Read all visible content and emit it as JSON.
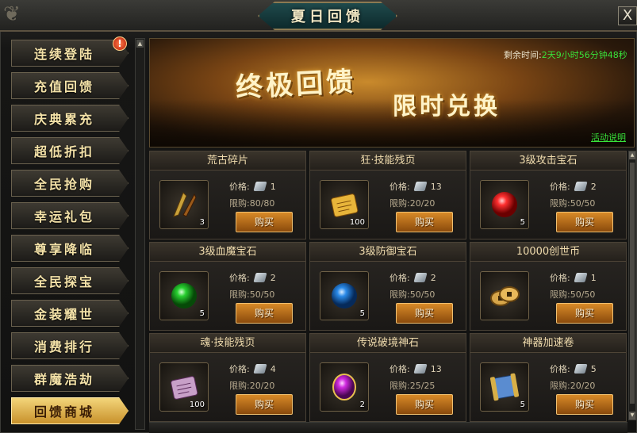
{
  "window": {
    "title": "夏日回馈",
    "close_label": "X"
  },
  "sidebar": {
    "items": [
      {
        "label": "连续登陆",
        "active": false,
        "alert": "!"
      },
      {
        "label": "充值回馈",
        "active": false
      },
      {
        "label": "庆典累充",
        "active": false
      },
      {
        "label": "超低折扣",
        "active": false
      },
      {
        "label": "全民抢购",
        "active": false
      },
      {
        "label": "幸运礼包",
        "active": false
      },
      {
        "label": "尊享降临",
        "active": false
      },
      {
        "label": "全民探宝",
        "active": false
      },
      {
        "label": "金装耀世",
        "active": false
      },
      {
        "label": "消费排行",
        "active": false
      },
      {
        "label": "群魔浩劫",
        "active": false
      },
      {
        "label": "回馈商城",
        "active": true
      }
    ]
  },
  "banner": {
    "title": "终极回馈",
    "subtitle": "限时兑换",
    "timer_label": "剩余时间:",
    "timer_value": "2天9小时56分钟48秒",
    "event_link": "活动说明"
  },
  "shop": {
    "price_label": "价格:",
    "limit_label": "限购:",
    "buy_label": "购买",
    "items": [
      {
        "name": "荒古碎片",
        "count": "3",
        "price": "1",
        "limit": "80/80",
        "icon": "ancient-fragment-icon",
        "color": "#c9a13a"
      },
      {
        "name": "狂·技能残页",
        "count": "100",
        "price": "13",
        "limit": "20/20",
        "icon": "skill-page-icon",
        "color": "#e8b53a"
      },
      {
        "name": "3级攻击宝石",
        "count": "5",
        "price": "2",
        "limit": "50/50",
        "icon": "red-gem-icon",
        "color": "#e01a1a"
      },
      {
        "name": "3级血魔宝石",
        "count": "5",
        "price": "2",
        "limit": "50/50",
        "icon": "green-gem-icon",
        "color": "#1ec428"
      },
      {
        "name": "3级防御宝石",
        "count": "5",
        "price": "2",
        "limit": "50/50",
        "icon": "blue-gem-icon",
        "color": "#1e7ee0"
      },
      {
        "name": "10000创世币",
        "count": "",
        "price": "1",
        "limit": "50/50",
        "icon": "coin-icon",
        "color": "#d7a64a"
      },
      {
        "name": "魂·技能残页",
        "count": "100",
        "price": "4",
        "limit": "20/20",
        "icon": "soul-page-icon",
        "color": "#c8a0c8"
      },
      {
        "name": "传说破境神石",
        "count": "2",
        "price": "13",
        "limit": "25/25",
        "icon": "purple-stone-icon",
        "color": "#d02ae0"
      },
      {
        "name": "神器加速卷",
        "count": "5",
        "price": "5",
        "limit": "20/20",
        "icon": "scroll-icon",
        "color": "#5a8cd0"
      }
    ]
  }
}
